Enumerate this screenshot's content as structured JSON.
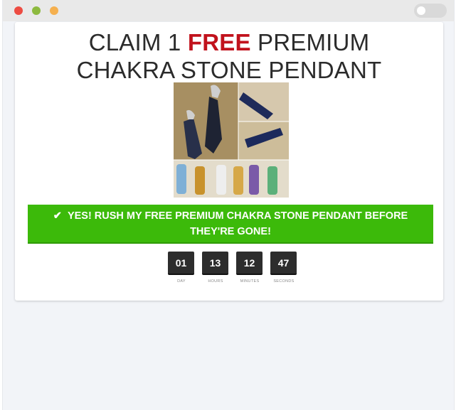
{
  "window": {
    "controls": [
      "close",
      "minimize",
      "maximize"
    ]
  },
  "headline": {
    "line1_before": "CLAIM 1 ",
    "line1_highlight": "FREE",
    "line1_after": " PREMIUM",
    "line2": "CHAKRA STONE PENDANT"
  },
  "product_image": {
    "alt": "chakra-stone-pendant-collage"
  },
  "cta": {
    "icon": "checkmark-icon",
    "label": "YES! RUSH MY FREE PREMIUM CHAKRA STONE PENDANT BEFORE THEY'RE GONE!"
  },
  "countdown": [
    {
      "value": "01",
      "label": "DAY"
    },
    {
      "value": "13",
      "label": "HOURS"
    },
    {
      "value": "12",
      "label": "MINUTES"
    },
    {
      "value": "47",
      "label": "SECONDS"
    }
  ],
  "colors": {
    "highlight": "#c1121c",
    "cta_background": "#3cba0a",
    "timer_box": "#2d2d2d"
  }
}
